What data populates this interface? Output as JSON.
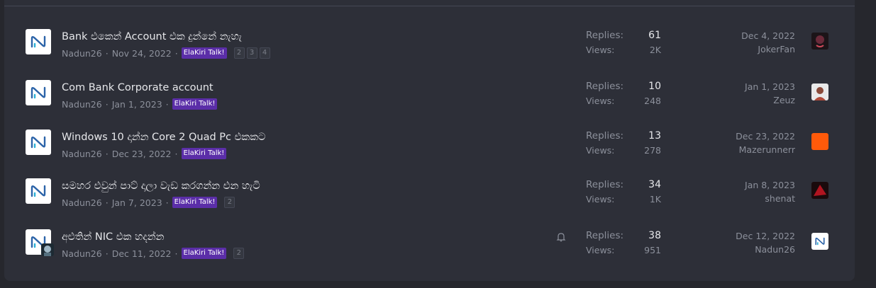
{
  "labels": {
    "replies": "Replies:",
    "views": "Views:",
    "separator": "·"
  },
  "threads": [
    {
      "title": "Bank එකෙන් Account එක දුන්නේ නැහැ",
      "author": "Nadun26",
      "date": "Nov 24, 2022",
      "prefix": "ElaKiri Talk!",
      "pages": [
        "2",
        "3",
        "4"
      ],
      "replies": "61",
      "views": "2K",
      "last_date": "Dec 4, 2022",
      "last_user": "JokerFan"
    },
    {
      "title": "Com Bank Corporate account",
      "author": "Nadun26",
      "date": "Jan 1, 2023",
      "prefix": "ElaKiri Talk!",
      "pages": [],
      "replies": "10",
      "views": "248",
      "last_date": "Jan 1, 2023",
      "last_user": "Zeuz"
    },
    {
      "title": "Windows 10 දාන්න Core 2 Quad Pc එකකට",
      "author": "Nadun26",
      "date": "Dec 23, 2022",
      "prefix": "ElaKiri Talk!",
      "pages": [],
      "replies": "13",
      "views": "278",
      "last_date": "Dec 23, 2022",
      "last_user": "Mazerunnerr"
    },
    {
      "title": "සමහර එවුන් පාට් දාලා වැඩ කරගන්න එන හැටි",
      "author": "Nadun26",
      "date": "Jan 7, 2023",
      "prefix": "ElaKiri Talk!",
      "pages": [
        "2"
      ],
      "replies": "34",
      "views": "1K",
      "last_date": "Jan 8, 2023",
      "last_user": "shenat"
    },
    {
      "title": "අළුතින් NIC එක හදන්න",
      "author": "Nadun26",
      "date": "Dec 11, 2022",
      "prefix": "ElaKiri Talk!",
      "pages": [
        "2"
      ],
      "replies": "38",
      "views": "951",
      "last_date": "Dec 12, 2022",
      "last_user": "Nadun26"
    }
  ],
  "colors": {
    "prefix_bg": "#5b2ea8",
    "logo_blue": "#2b63a8",
    "logo_cyan": "#2bb0d6"
  }
}
